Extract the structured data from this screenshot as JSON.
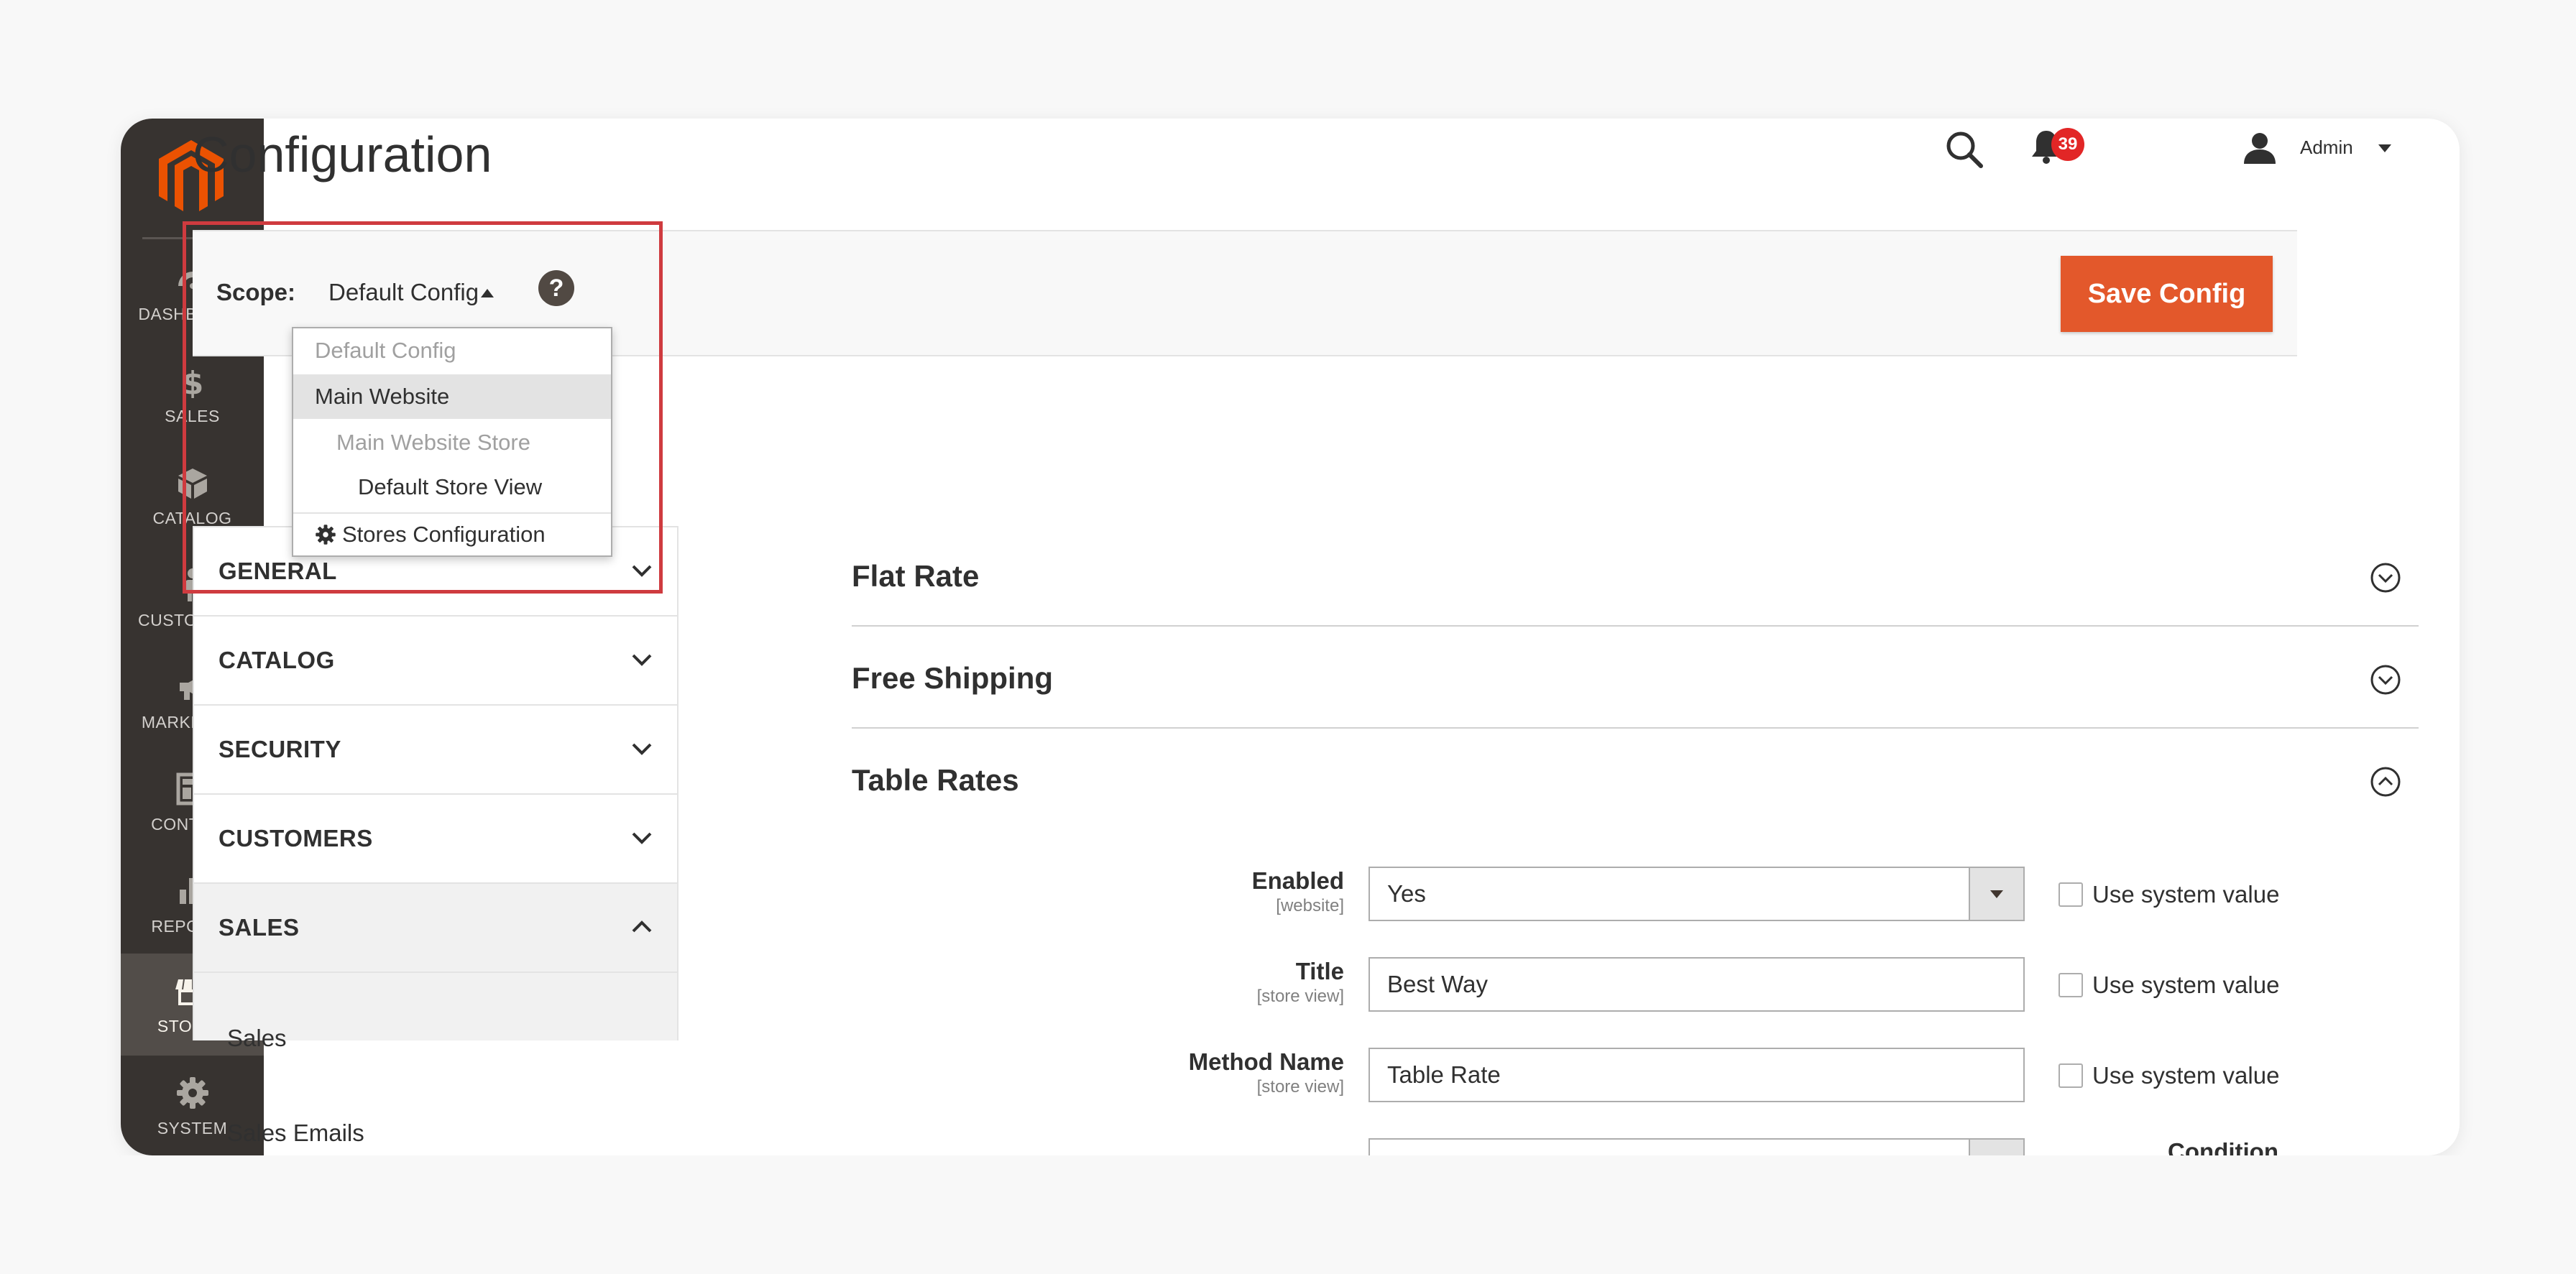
{
  "colors": {
    "sidebar_bg": "#373330",
    "sidebar_active": "#524d49",
    "accent": "#e3582b",
    "logo": "#eb5202",
    "badge": "#e22626",
    "highlight": "#cf3b3f"
  },
  "sidebar": {
    "items": [
      {
        "label": "DASHBOARD",
        "icon": "dashboard-icon"
      },
      {
        "label": "SALES",
        "icon": "dollar-icon"
      },
      {
        "label": "CATALOG",
        "icon": "cube-icon"
      },
      {
        "label": "CUSTOMERS",
        "icon": "person-icon"
      },
      {
        "label": "MARKETING",
        "icon": "megaphone-icon"
      },
      {
        "label": "CONTENT",
        "icon": "layout-icon"
      },
      {
        "label": "REPORTS",
        "icon": "bar-chart-icon"
      },
      {
        "label": "STORES",
        "icon": "store-icon",
        "active": true
      },
      {
        "label": "SYSTEM",
        "icon": "gear-icon"
      }
    ]
  },
  "header": {
    "title": "Configuration",
    "notifications_count": "39",
    "user": "Admin"
  },
  "scope": {
    "label": "Scope:",
    "value": "Default Config",
    "help": "?",
    "save_label": "Save Config",
    "options": [
      {
        "label": "Default Config",
        "state": "disabled",
        "indent": 0
      },
      {
        "label": "Main Website",
        "state": "selected",
        "indent": 0
      },
      {
        "label": "Main Website Store",
        "state": "disabled",
        "indent": 1
      },
      {
        "label": "Default Store View",
        "state": "normal",
        "indent": 2
      },
      {
        "label": "Stores Configuration",
        "state": "normal",
        "indent": 0,
        "icon": "gear-icon"
      }
    ]
  },
  "tabs": {
    "items": [
      {
        "label": "GENERAL"
      },
      {
        "label": "CATALOG"
      },
      {
        "label": "SECURITY"
      },
      {
        "label": "CUSTOMERS"
      },
      {
        "label": "SALES",
        "open": true
      }
    ],
    "sales_sub": [
      "Sales",
      "Sales Emails"
    ]
  },
  "sections": [
    {
      "title": "Flat Rate",
      "expanded": false
    },
    {
      "title": "Free Shipping",
      "expanded": false
    },
    {
      "title": "Table Rates",
      "expanded": true
    }
  ],
  "table_rates": {
    "fields": [
      {
        "label": "Enabled",
        "scope": "[website]",
        "value": "Yes",
        "type": "select",
        "use_system": "Use system value"
      },
      {
        "label": "Title",
        "scope": "[store view]",
        "value": "Best Way",
        "type": "text",
        "use_system": "Use system value"
      },
      {
        "label": "Method Name",
        "scope": "[store view]",
        "value": "Table Rate",
        "type": "text",
        "use_system": "Use system value"
      },
      {
        "label": "Condition",
        "scope": "",
        "value": "",
        "type": "select",
        "use_system": ""
      }
    ]
  }
}
